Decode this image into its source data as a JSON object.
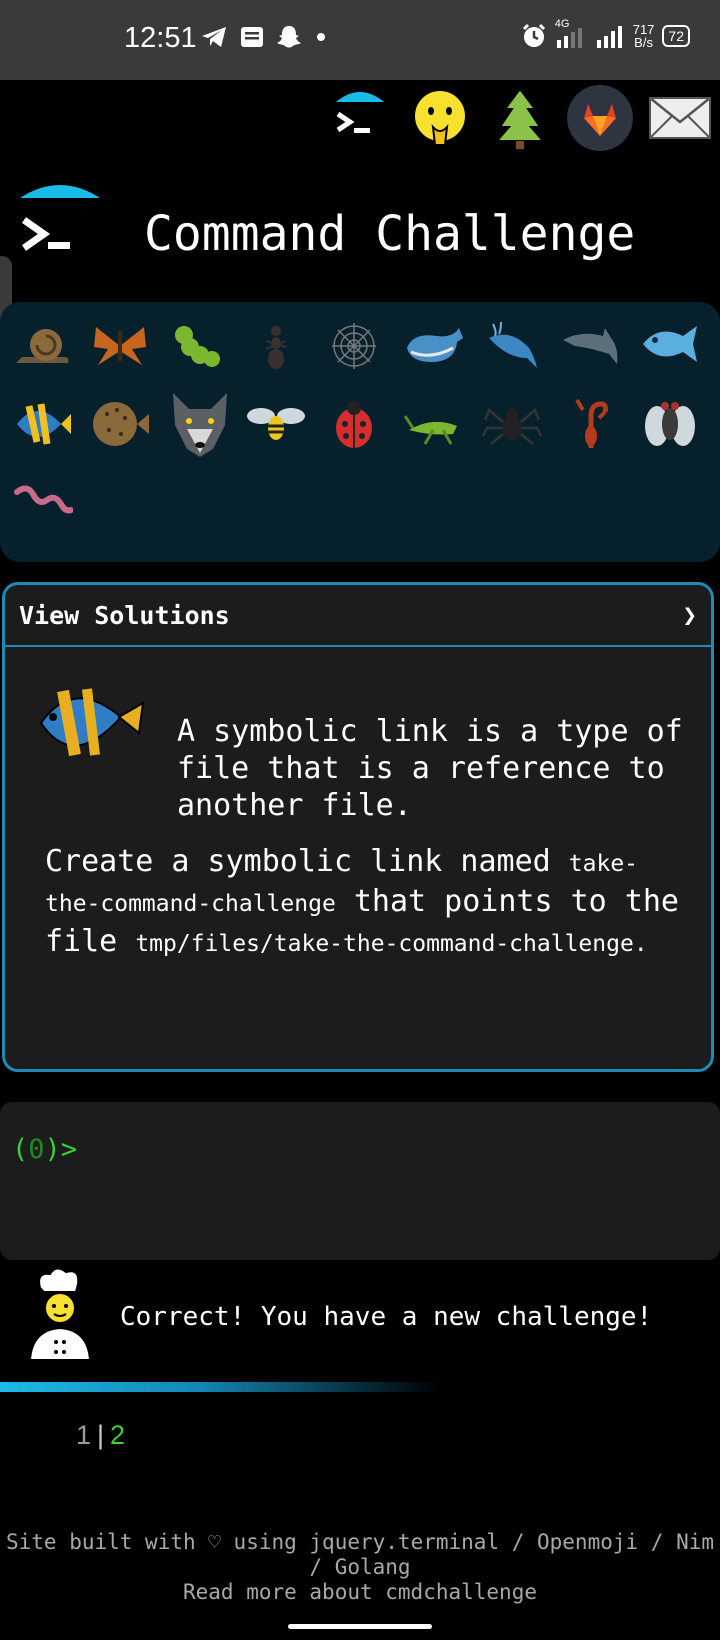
{
  "status_bar": {
    "time": "12:51",
    "network": "4G",
    "speed_value": "717",
    "speed_unit": "B/s",
    "battery": "72"
  },
  "header": {
    "title": "Command Challenge"
  },
  "solutions": {
    "label": "View Solutions",
    "chevron": "❯"
  },
  "challenge": {
    "line1": "A symbolic link is a type of file that is a reference to another file.",
    "task_a": "Create a symbolic link named ",
    "task_code1": "take-the-command-challenge",
    "task_b": " that points to the file ",
    "task_code2": "tmp/files/take-the-command-challenge",
    "task_c": "."
  },
  "terminal": {
    "prompt_open": "(",
    "prompt_count": "0",
    "prompt_close": ")>"
  },
  "message": "Correct! You have a new challenge!",
  "pager": {
    "page1": "1",
    "sep": "|",
    "page2": "2"
  },
  "footer": {
    "line1": "Site built with ♡ using jquery.terminal / Openmoji / Nim / Golang",
    "line2": "Read more about cmdchallenge"
  },
  "emoji_grid": [
    "snail",
    "butterfly",
    "caterpillar",
    "ant",
    "spider-web",
    "whale",
    "spouting-whale",
    "dolphin",
    "fish",
    "tropical-fish",
    "blowfish",
    "wolf",
    "bee",
    "ladybug",
    "cricket",
    "spider",
    "scorpion",
    "fly",
    "worm"
  ]
}
